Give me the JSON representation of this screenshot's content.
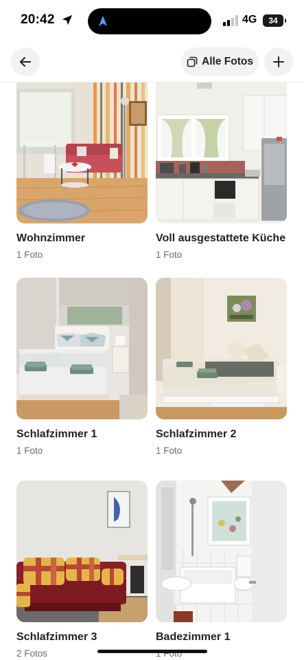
{
  "status_bar": {
    "time": "20:42",
    "network": "4G",
    "battery": "34"
  },
  "nav": {
    "all_photos_label": "Alle Fotos"
  },
  "rooms": [
    {
      "title": "Wohnzimmer",
      "count": "1 Foto"
    },
    {
      "title": "Voll ausgestattete Küche",
      "count": "1 Foto"
    },
    {
      "title": "Schlafzimmer 1",
      "count": "1 Foto"
    },
    {
      "title": "Schlafzimmer 2",
      "count": "1 Foto"
    },
    {
      "title": "Schlafzimmer 3",
      "count": "2 Fotos"
    },
    {
      "title": "Badezimmer 1",
      "count": "1 Foto"
    }
  ],
  "colors": {
    "accent_blue": "#4aa3ff",
    "sofa_red": "#c7515b",
    "floor_wood": "#d9a56b"
  }
}
